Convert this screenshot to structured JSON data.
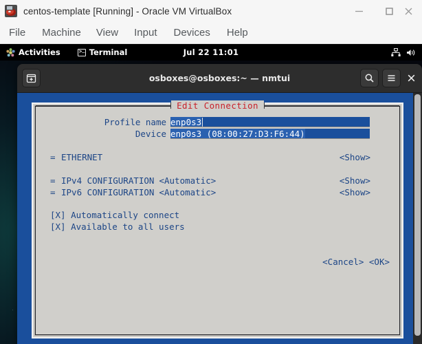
{
  "host_window": {
    "icon": "virtualbox-icon",
    "title": "centos-template [Running] - Oracle VM VirtualBox",
    "controls": [
      {
        "name": "minimize-button",
        "glyph": "minimize-icon"
      },
      {
        "name": "maximize-button",
        "glyph": "maximize-icon"
      },
      {
        "name": "close-button",
        "glyph": "close-icon"
      }
    ],
    "menubar": [
      {
        "label": "File"
      },
      {
        "label": "Machine"
      },
      {
        "label": "View"
      },
      {
        "label": "Input"
      },
      {
        "label": "Devices"
      },
      {
        "label": "Help"
      }
    ]
  },
  "gnome_topbar": {
    "activities_label": "Activities",
    "activities_icon": "gnome-activities-icon",
    "app_label": "Terminal",
    "app_icon": "terminal-icon",
    "clock": "Jul 22  11:01",
    "status_icons": [
      {
        "name": "wired-network-icon"
      },
      {
        "name": "volume-icon"
      }
    ]
  },
  "terminal": {
    "title": "osboxes@osboxes:~ — nmtui",
    "header_buttons": [
      {
        "name": "new-tab-button",
        "icon": "new-tab-icon"
      },
      {
        "name": "search-button",
        "icon": "search-icon"
      },
      {
        "name": "hamburger-menu-button",
        "icon": "hamburger-icon"
      },
      {
        "name": "window-close-button",
        "icon": "close-icon"
      }
    ],
    "colors": {
      "background": "#1a4f9c",
      "dialog_background": "#d0cfcb",
      "text": "#1c4586",
      "title_accent": "#c8202a",
      "selection": "#2a61b0"
    }
  },
  "nmtui": {
    "dialog_title": "Edit Connection",
    "fields": [
      {
        "label": "Profile name",
        "value": "enp0s3",
        "has_caret": true
      },
      {
        "label": "Device",
        "value": "enp0s3 (08:00:27:D3:F6:44)",
        "has_caret": false
      }
    ],
    "sections": [
      {
        "marker": "=",
        "label": "ETHERNET",
        "value": "",
        "action": "<Show>"
      },
      {
        "marker": "=",
        "label": "IPv4 CONFIGURATION",
        "value": "<Automatic>",
        "action": "<Show>"
      },
      {
        "marker": "=",
        "label": "IPv6 CONFIGURATION",
        "value": "<Automatic>",
        "action": "<Show>"
      }
    ],
    "checkboxes": [
      {
        "text": "[X] Automatically connect",
        "checked": true
      },
      {
        "text": "[X] Available to all users",
        "checked": true
      }
    ],
    "actions": "<Cancel> <OK>",
    "action_buttons": [
      {
        "label": "<Cancel>"
      },
      {
        "label": "<OK>"
      }
    ]
  }
}
